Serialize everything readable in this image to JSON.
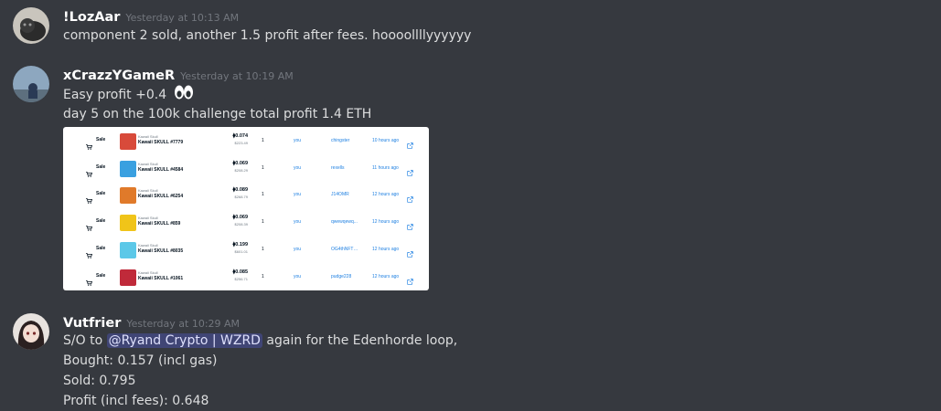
{
  "messages": [
    {
      "username": "!LozAar",
      "timestamp": "Yesterday at 10:13 AM",
      "lines": [
        "component 2 sold, another 1.5 profit after fees. hoooollllyyyyyy"
      ]
    },
    {
      "username": "xCrazzYGameR",
      "timestamp": "Yesterday at 10:19 AM",
      "lines": [
        "Easy profit +0.4",
        "day 5 on the 100k challenge total profit 1.4 ETH"
      ],
      "emoji": "eyes",
      "image": {
        "sale_label": "Sale",
        "rows": [
          {
            "collection": "Kawaii Skull",
            "name": "Kawaii SKULL #7779",
            "price": "0.074",
            "usd": "$223.49",
            "qty": "1",
            "from": "you",
            "to": "chingster",
            "time": "10 hours ago",
            "thumb_color": "#d84a3a"
          },
          {
            "collection": "Kawaii Skull",
            "name": "Kawaii SKULL #4584",
            "price": "0.069",
            "usd": "$208.29",
            "qty": "1",
            "from": "you",
            "to": "rexells",
            "time": "11 hours ago",
            "thumb_color": "#3aa0e0"
          },
          {
            "collection": "Kawaii Skull",
            "name": "Kawaii SKULL #6254",
            "price": "0.089",
            "usd": "$268.79",
            "qty": "1",
            "from": "you",
            "to": "J14OMR",
            "time": "12 hours ago",
            "thumb_color": "#e07a2a"
          },
          {
            "collection": "Kawaii Skull",
            "name": "Kawaii SKULL #859",
            "price": "0.069",
            "usd": "$208.39",
            "qty": "1",
            "from": "you",
            "to": "qwewqewq...",
            "time": "12 hours ago",
            "thumb_color": "#f0c419"
          },
          {
            "collection": "Kawaii Skull",
            "name": "Kawaii SKULL #8035",
            "price": "0.199",
            "usd": "$601.01",
            "qty": "1",
            "from": "you",
            "to": "OG4thNFTgirl",
            "time": "12 hours ago",
            "thumb_color": "#5cc8e8"
          },
          {
            "collection": "Kawaii Skull",
            "name": "Kawaii SKULL #1061",
            "price": "0.085",
            "usd": "$256.71",
            "qty": "1",
            "from": "you",
            "to": "pudge228",
            "time": "12 hours ago",
            "thumb_color": "#c02a3a"
          }
        ]
      }
    },
    {
      "username": "Vutfrier",
      "timestamp": "Yesterday at 10:29 AM",
      "line1_prefix": "S/O to",
      "mention": "@Ryand Crypto | WZRD",
      "line1_suffix": " again for the Edenhorde loop,",
      "lines": [
        "Bought:  0.157 (incl gas)",
        "Sold: 0.795",
        "Profit (incl fees): 0.648"
      ]
    }
  ],
  "colors": {
    "background": "#36393f",
    "username": "#ffffff",
    "timestamp": "#72767d",
    "text": "#dcddde",
    "mention_bg": "#414675",
    "link": "#2081e2"
  }
}
